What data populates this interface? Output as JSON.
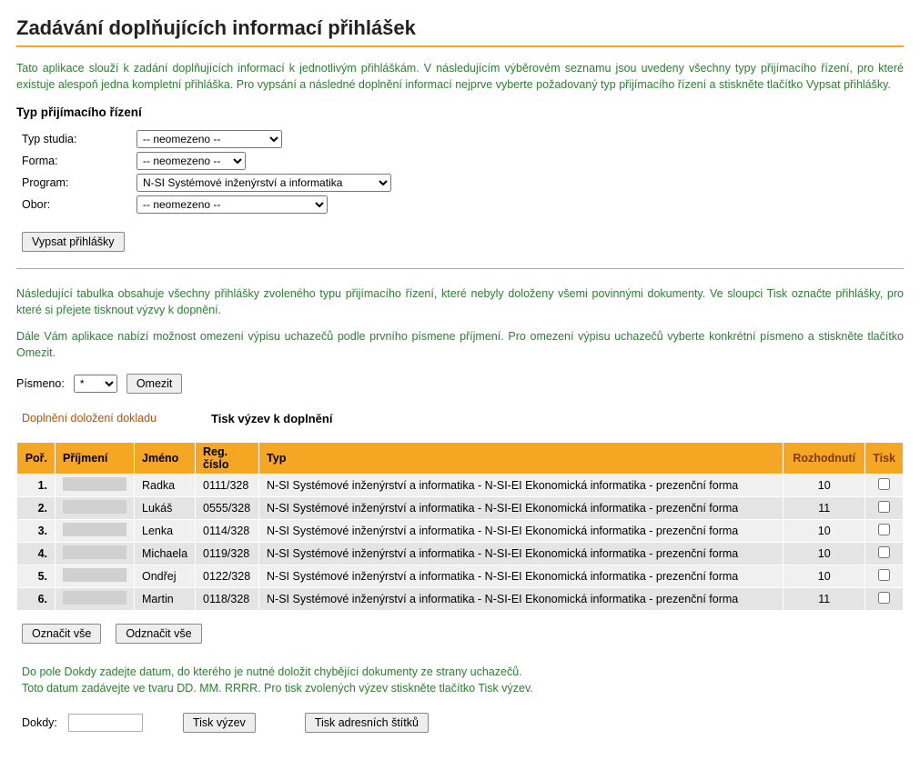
{
  "page": {
    "title": "Zadávání doplňujících informací přihlášek",
    "intro": "Tato aplikace slouží k zadání doplňujících informací k jednotlivým přihláškám. V následujícím výběrovém seznamu jsou uvedeny všechny typy přijímacího řízení, pro které existuje alespoň jedna kompletní přihláška. Pro vypsání a následné doplnění informací nejprve vyberte požadovaný typ přijímacího řízení a stiskněte tlačítko Vypsat přihlášky."
  },
  "filter": {
    "heading": "Typ přijímacího řízení",
    "fields": {
      "typ_studia": {
        "label": "Typ studia:",
        "value": "-- neomezeno --"
      },
      "forma": {
        "label": "Forma:",
        "value": "-- neomezeno --"
      },
      "program": {
        "label": "Program:",
        "value": "N-SI Systémové inženýrství a informatika"
      },
      "obor": {
        "label": "Obor:",
        "value": "-- neomezeno --"
      }
    },
    "submit": "Vypsat přihlášky"
  },
  "note1": "Následující tabulka obsahuje všechny přihlášky zvoleného typu přijímacího řízení, které nebyly doloženy všemi povinnými dokumenty. Ve sloupci Tisk označte přihlášky, pro které si přejete tisknout výzvy k dopnění.",
  "note2": "Dále Vám aplikace nabízí možnost omezení výpisu uchazečů podle prvního písmene příjmení. Pro omezení výpisu uchazečů vyberte konkrétní písmeno a stiskněte tlačítko Omezit.",
  "letterFilter": {
    "label": "Písmeno:",
    "value": "*",
    "button": "Omezit"
  },
  "tabs": {
    "inactive": "Doplnění doložení dokladu",
    "active": "Tisk výzev k doplnění"
  },
  "table": {
    "headers": {
      "por": "Poř.",
      "prijmeni": "Příjmení",
      "jmeno": "Jméno",
      "reg": "Reg. číslo",
      "typ": "Typ",
      "rozhodnuti": "Rozhodnutí",
      "tisk": "Tisk"
    },
    "typValue": "N-SI Systémové inženýrství a informatika - N-SI-EI Ekonomická informatika - prezenční forma",
    "rows": [
      {
        "por": "1.",
        "jmeno": "Radka",
        "reg": "0111/328",
        "rozhodnuti": "10"
      },
      {
        "por": "2.",
        "jmeno": "Lukáš",
        "reg": "0555/328",
        "rozhodnuti": "11"
      },
      {
        "por": "3.",
        "jmeno": "Lenka",
        "reg": "0114/328",
        "rozhodnuti": "10"
      },
      {
        "por": "4.",
        "jmeno": "Michaela",
        "reg": "0119/328",
        "rozhodnuti": "10"
      },
      {
        "por": "5.",
        "jmeno": "Ondřej",
        "reg": "0122/328",
        "rozhodnuti": "10"
      },
      {
        "por": "6.",
        "jmeno": "Martin",
        "reg": "0118/328",
        "rozhodnuti": "11"
      }
    ]
  },
  "bulk": {
    "selectAll": "Označit vše",
    "deselectAll": "Odznačit vše"
  },
  "footer": {
    "note": "Do pole Dokdy zadejte datum, do kterého je nutné doložit chybějící dokumenty ze strany uchazečů.\nToto datum zadávejte ve tvaru DD. MM. RRRR. Pro tisk zvolených výzev stiskněte tlačítko Tisk výzev.",
    "dokdyLabel": "Dokdy:",
    "dokdyValue": "",
    "tiskVyzev": "Tisk výzev",
    "tiskStitku": "Tisk adresních štítků"
  }
}
